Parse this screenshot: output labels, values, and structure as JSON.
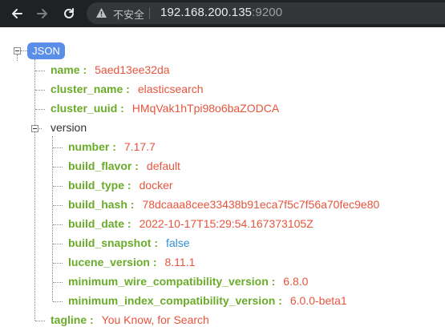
{
  "browser": {
    "security_label": "不安全",
    "url_host": "192.168.200.135",
    "url_port": ":9200"
  },
  "json": {
    "root_label": "JSON",
    "fields": [
      {
        "key": "name :",
        "value": "5aed13ee32da"
      },
      {
        "key": "cluster_name :",
        "value": "elasticsearch"
      },
      {
        "key": "cluster_uuid :",
        "value": "HMqVak1hTpi98o6baZODCA"
      }
    ],
    "version": {
      "label": "version",
      "fields": [
        {
          "key": "number :",
          "value": "7.17.7"
        },
        {
          "key": "build_flavor :",
          "value": "default"
        },
        {
          "key": "build_type :",
          "value": "docker"
        },
        {
          "key": "build_hash :",
          "value": "78dcaaa8cee33438b91eca7f5c7f56a70fec9e80"
        },
        {
          "key": "build_date :",
          "value": "2022-10-17T15:29:54.167373105Z"
        },
        {
          "key": "build_snapshot :",
          "value": "false"
        },
        {
          "key": "lucene_version :",
          "value": "8.11.1"
        },
        {
          "key": "minimum_wire_compatibility_version :",
          "value": "6.8.0"
        },
        {
          "key": "minimum_index_compatibility_version :",
          "value": "6.0.0-beta1"
        }
      ]
    },
    "tagline": {
      "key": "tagline :",
      "value": "You Know, for Search"
    }
  }
}
